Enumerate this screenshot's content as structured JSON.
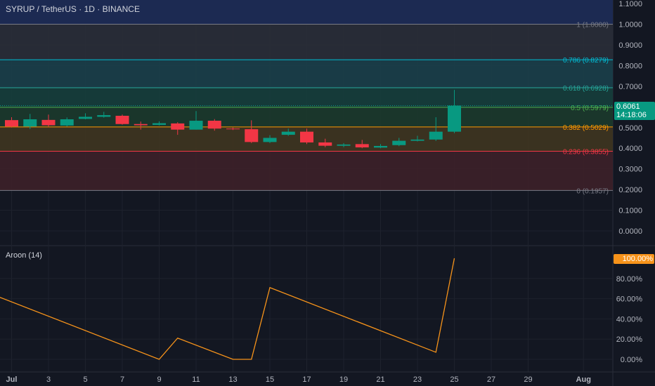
{
  "header": {
    "symbol_line": "SYRUP / TetherUS · 1D · BINANCE"
  },
  "price_badge": {
    "price": "0.6061",
    "countdown": "14:18:06"
  },
  "indicator": {
    "title": "Aroon (14)",
    "current_badge": "100.00%"
  },
  "price_axis": {
    "ticks": [
      "1.1000",
      "1.0000",
      "0.9000",
      "0.8000",
      "0.7000",
      "0.6000",
      "0.5000",
      "0.4000",
      "0.3000",
      "0.2000",
      "0.1000",
      "0.0000"
    ]
  },
  "aroon_axis": {
    "ticks": [
      "80.00%",
      "60.00%",
      "40.00%",
      "20.00%",
      "0.00%"
    ]
  },
  "time_axis": {
    "labels": [
      "Jul",
      "3",
      "5",
      "7",
      "9",
      "11",
      "13",
      "15",
      "17",
      "19",
      "21",
      "23",
      "25",
      "27",
      "29",
      "Aug"
    ]
  },
  "fibonacci": {
    "levels": [
      {
        "label": "1 (1.0000)",
        "value": 1.0,
        "line": "#787b86",
        "text": "#787b86"
      },
      {
        "label": "0.786 (0.8279)",
        "value": 0.8279,
        "line": "#00bcd4",
        "text": "#00bcd4"
      },
      {
        "label": "0.618 (0.6928)",
        "value": 0.6928,
        "line": "#26a69a",
        "text": "#26a69a"
      },
      {
        "label": "0.5 (0.5979)",
        "value": 0.5979,
        "line": "#4caf50",
        "text": "#4caf50"
      },
      {
        "label": "0.382 (0.5029)",
        "value": 0.5029,
        "line": "#ff9800",
        "text": "#ff9800"
      },
      {
        "label": "0.236 (0.3855)",
        "value": 0.3855,
        "line": "#f23645",
        "text": "#f23645"
      },
      {
        "label": "0 (0.1957)",
        "value": 0.1957,
        "line": "#787b86",
        "text": "#787b86"
      }
    ]
  },
  "colors": {
    "up": "#089981",
    "down": "#f23645",
    "aroon_line": "#f7931a",
    "background": "#131722",
    "grid": "#1e222d"
  },
  "chart_data": [
    {
      "type": "candlestick",
      "title": "SYRUP / TetherUS · 1D · BINANCE",
      "x": [
        "Jul 1",
        "Jul 2",
        "Jul 3",
        "Jul 4",
        "Jul 5",
        "Jul 6",
        "Jul 7",
        "Jul 8",
        "Jul 9",
        "Jul 10",
        "Jul 11",
        "Jul 12",
        "Jul 13",
        "Jul 14",
        "Jul 15",
        "Jul 16",
        "Jul 17",
        "Jul 18",
        "Jul 19",
        "Jul 20",
        "Jul 21",
        "Jul 22",
        "Jul 23",
        "Jul 24",
        "Jul 25"
      ],
      "open": [
        0.536,
        0.505,
        0.537,
        0.51,
        0.542,
        0.552,
        0.557,
        0.517,
        0.513,
        0.52,
        0.49,
        0.533,
        0.495,
        0.492,
        0.43,
        0.465,
        0.48,
        0.428,
        0.412,
        0.42,
        0.403,
        0.415,
        0.436,
        0.442,
        0.48
      ],
      "high": [
        0.55,
        0.566,
        0.563,
        0.549,
        0.569,
        0.576,
        0.563,
        0.529,
        0.53,
        0.526,
        0.58,
        0.541,
        0.5,
        0.535,
        0.463,
        0.495,
        0.495,
        0.446,
        0.425,
        0.44,
        0.42,
        0.45,
        0.46,
        0.55,
        0.682
      ],
      "close": [
        0.505,
        0.54,
        0.511,
        0.54,
        0.552,
        0.56,
        0.517,
        0.511,
        0.521,
        0.49,
        0.533,
        0.495,
        0.492,
        0.43,
        0.45,
        0.48,
        0.428,
        0.412,
        0.418,
        0.404,
        0.411,
        0.436,
        0.442,
        0.48,
        0.606
      ],
      "low": [
        0.5,
        0.493,
        0.502,
        0.505,
        0.54,
        0.548,
        0.514,
        0.49,
        0.51,
        0.465,
        0.49,
        0.485,
        0.488,
        0.425,
        0.425,
        0.46,
        0.42,
        0.405,
        0.405,
        0.4,
        0.4,
        0.41,
        0.433,
        0.435,
        0.473
      ],
      "ylim": [
        -0.02,
        1.12
      ],
      "fib_levels": [
        1.0,
        0.8279,
        0.6928,
        0.5979,
        0.5029,
        0.3855,
        0.1957
      ]
    },
    {
      "type": "line",
      "title": "Aroon (14)",
      "x": [
        "Jun 30",
        "Jul 9",
        "Jul 10",
        "Jul 13",
        "Jul 14",
        "Jul 15",
        "Jul 24",
        "Jul 25"
      ],
      "series": [
        {
          "values": [
            64,
            0,
            21,
            0,
            0,
            71,
            7,
            100
          ]
        }
      ],
      "ylim": [
        0,
        100
      ]
    }
  ]
}
